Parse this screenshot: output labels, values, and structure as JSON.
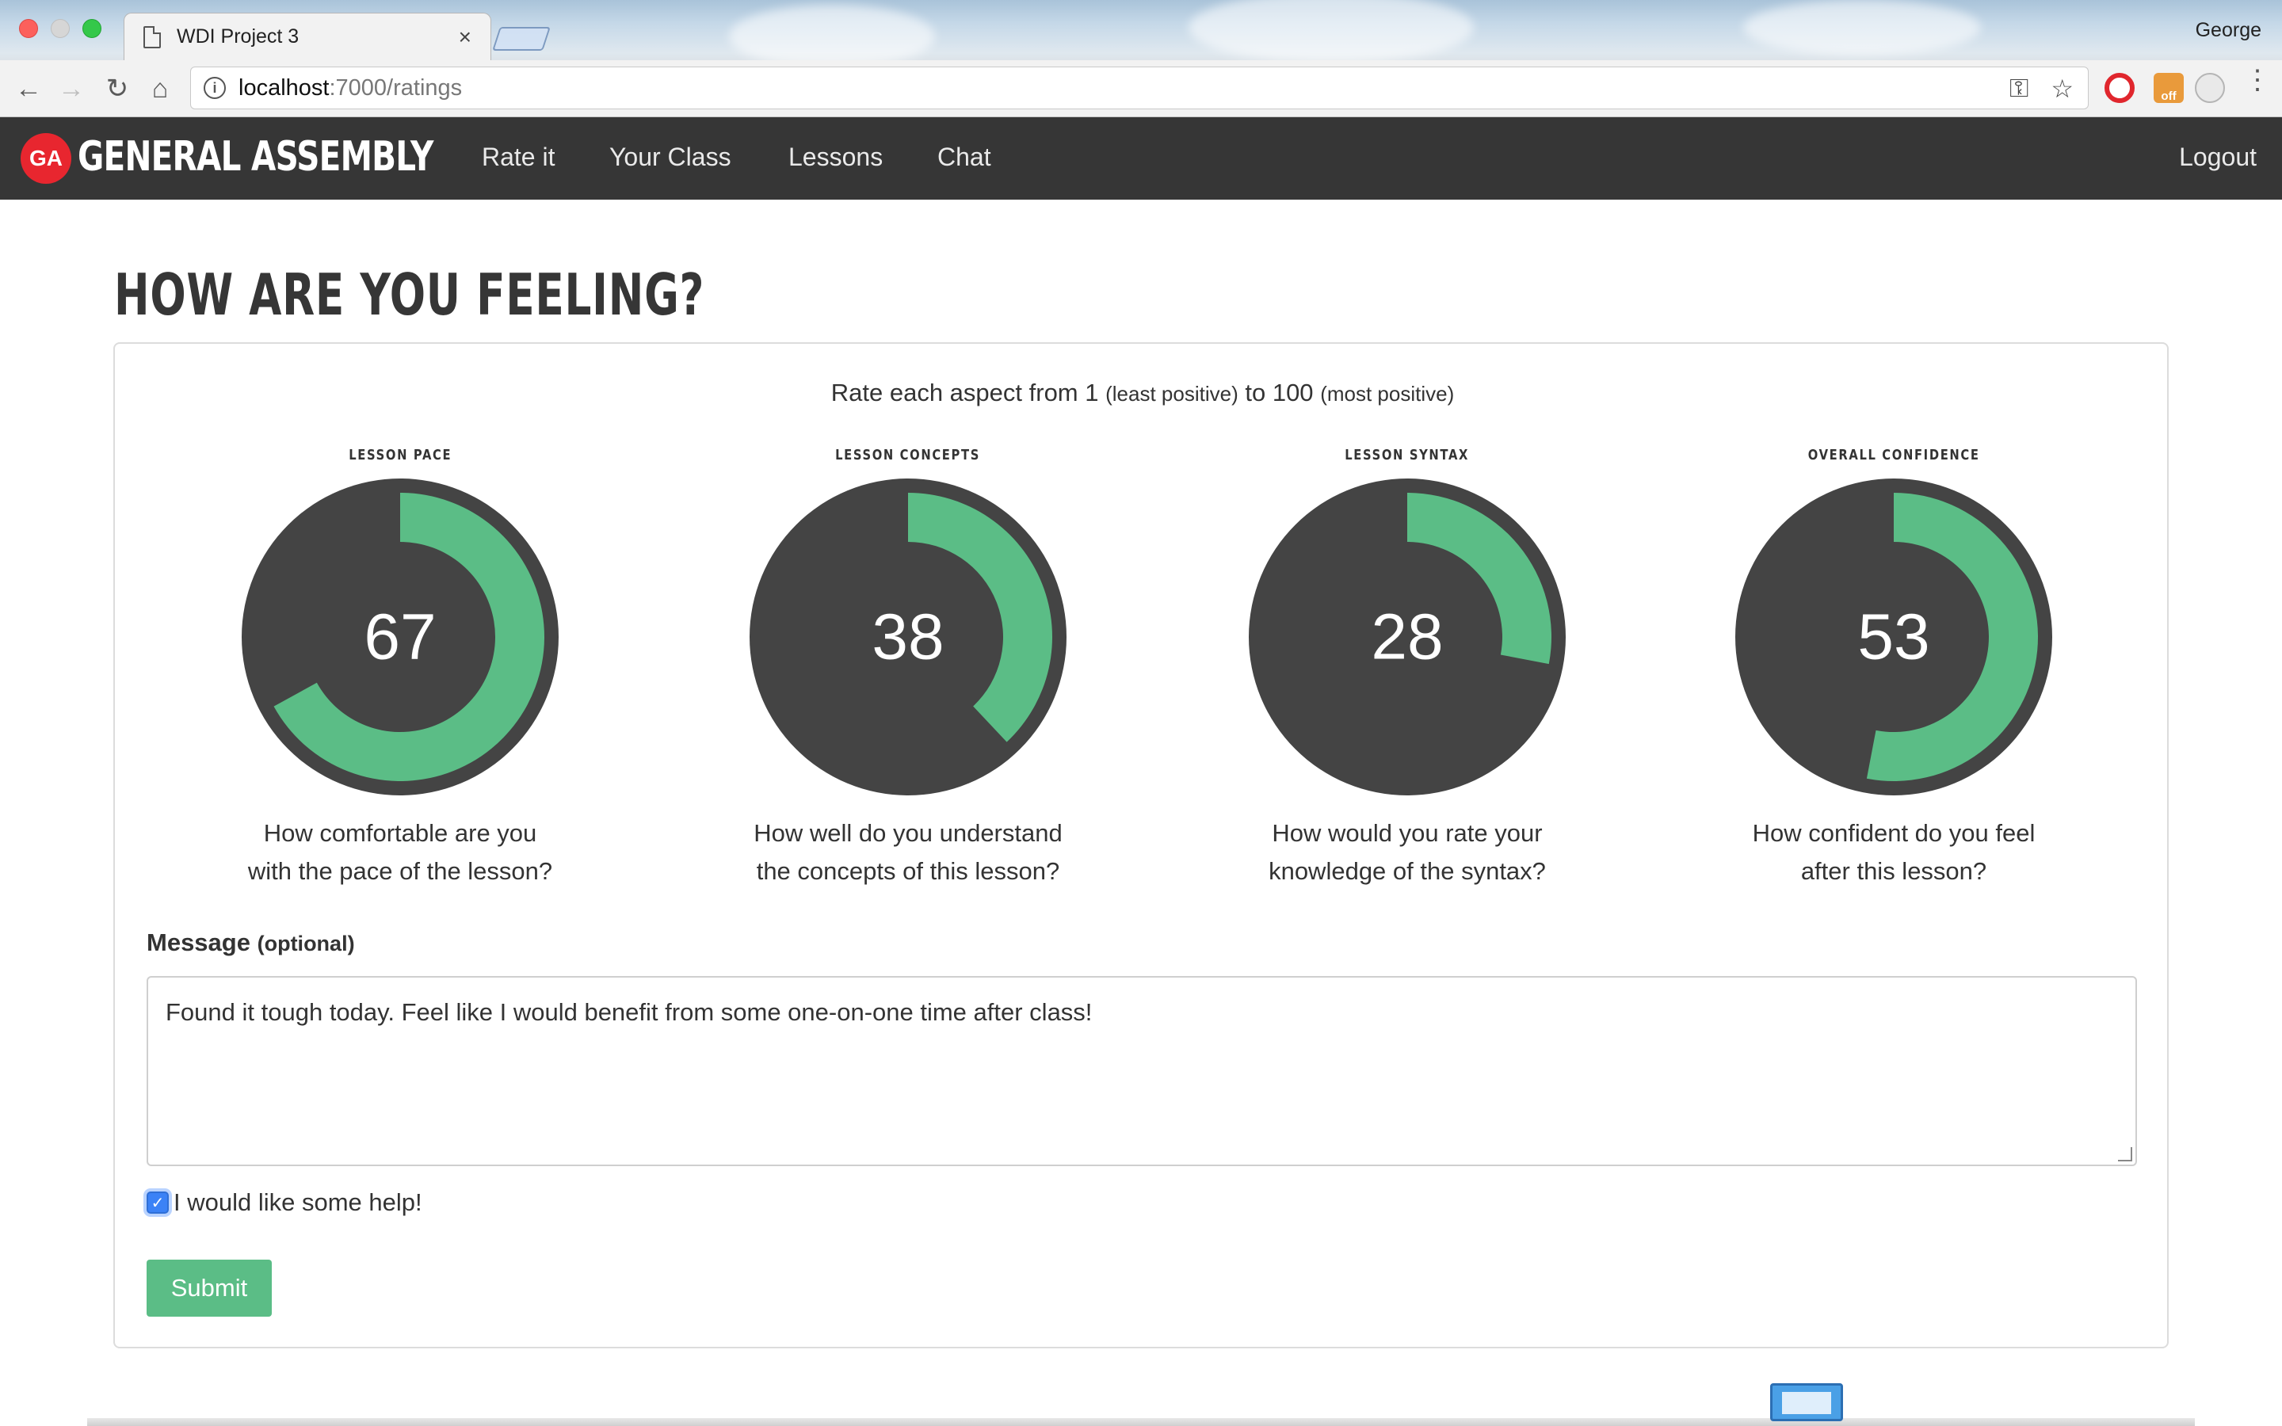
{
  "browser": {
    "tab_title": "WDI Project 3",
    "tab_close": "×",
    "profile_name": "George",
    "url_host": "localhost",
    "url_path": ":7000/ratings",
    "ext_off_label": "off"
  },
  "navbar": {
    "logo_badge": "GA",
    "logo_text": "GENERAL ASSEMBLY",
    "links": [
      "Rate it",
      "Your Class",
      "Lessons",
      "Chat"
    ],
    "logout": "Logout"
  },
  "page": {
    "title": "HOW ARE YOU FEELING?",
    "instructions": {
      "part1": "Rate each aspect from 1",
      "least": "(least positive)",
      "part2": "to 100",
      "most": "(most positive)"
    }
  },
  "dials": [
    {
      "label": "LESSON PACE",
      "value": 67,
      "q1": "How comfortable are you",
      "q2": "with the pace of the lesson?"
    },
    {
      "label": "LESSON CONCEPTS",
      "value": 38,
      "q1": "How well do you understand",
      "q2": "the concepts of this lesson?"
    },
    {
      "label": "LESSON SYNTAX",
      "value": 28,
      "q1": "How would you rate your",
      "q2": "knowledge of the syntax?"
    },
    {
      "label": "OVERALL CONFIDENCE",
      "value": 53,
      "q1": "How confident do you feel",
      "q2": "after this lesson?"
    }
  ],
  "form": {
    "message_label": "Message",
    "message_optional": "(optional)",
    "message_value": "Found it tough today. Feel like I would benefit from some one-on-one time after class!",
    "help_checked": true,
    "help_label": "I would like some help!",
    "submit_label": "Submit"
  },
  "colors": {
    "navbar_bg": "#363636",
    "dial_bg": "#444444",
    "dial_fill": "#5bbd86",
    "submit_bg": "#5bbd86",
    "brand_red": "#e8262f"
  }
}
